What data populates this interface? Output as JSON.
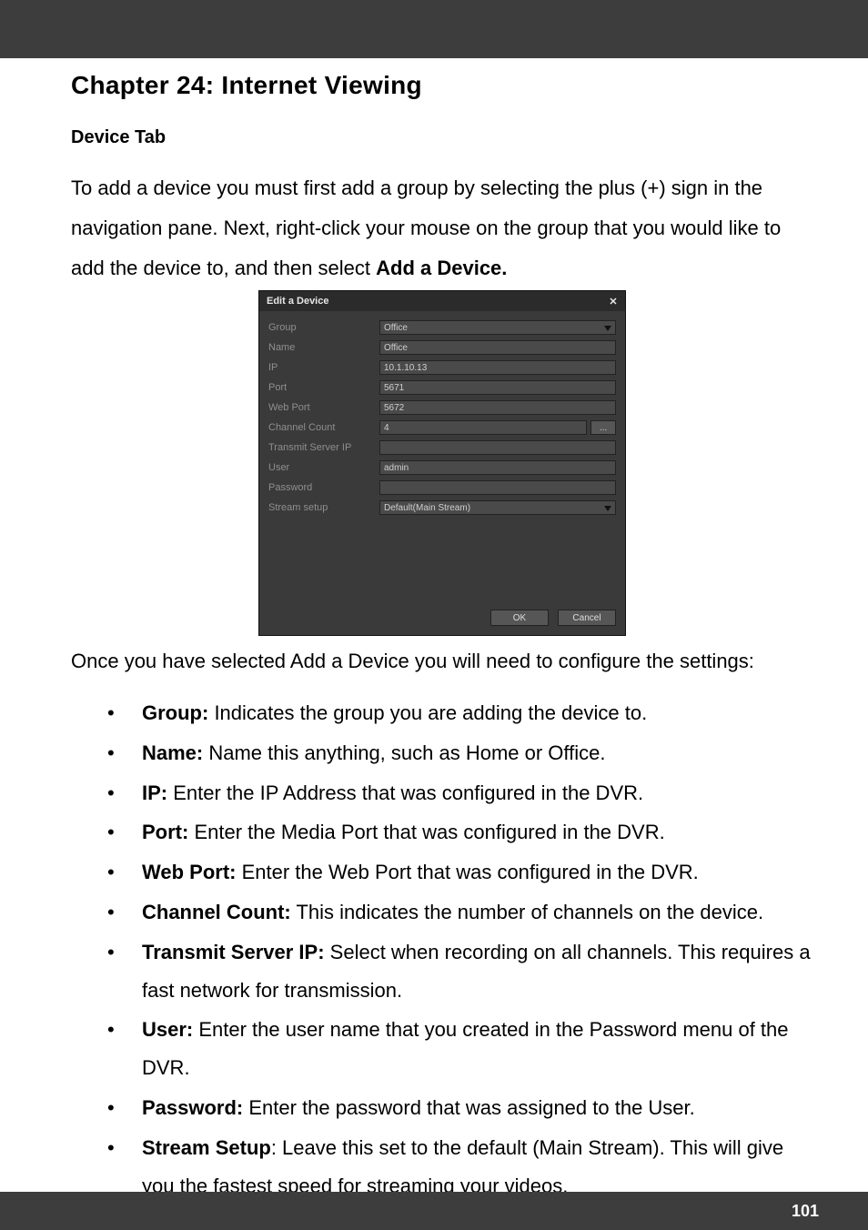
{
  "header": {
    "chapter_title": "Chapter 24: Internet Viewing"
  },
  "section": {
    "heading": "Device Tab"
  },
  "intro": {
    "text_a": "To add a device you must first add a group by selecting the plus (+) sign in the navigation pane. Next, right-click your mouse on the group that you would like to add the device to, and then select ",
    "text_b": "Add a Device."
  },
  "dialog": {
    "title": "Edit a Device",
    "fields": {
      "group": {
        "label": "Group",
        "value": "Office"
      },
      "name": {
        "label": "Name",
        "value": "Office"
      },
      "ip": {
        "label": "IP",
        "value": "10.1.10.13"
      },
      "port": {
        "label": "Port",
        "value": "5671"
      },
      "web_port": {
        "label": "Web Port",
        "value": "5672"
      },
      "channel_count": {
        "label": "Channel Count",
        "value": "4",
        "ellipsis": "..."
      },
      "transmit_server_ip": {
        "label": "Transmit Server IP",
        "value": ""
      },
      "user": {
        "label": "User",
        "value": "admin"
      },
      "password": {
        "label": "Password",
        "value": ""
      },
      "stream_setup": {
        "label": "Stream setup",
        "value": "Default(Main Stream)"
      }
    },
    "buttons": {
      "ok": "OK",
      "cancel": "Cancel"
    },
    "close_glyph": "✕"
  },
  "after_dialog": {
    "text": "Once you have selected Add a Device you will need to configure the settings:"
  },
  "bullets": [
    {
      "term": "Group:",
      "desc": " Indicates the group you are adding the device to."
    },
    {
      "term": "Name:",
      "desc": " Name this anything, such as Home or Office."
    },
    {
      "term": "IP:",
      "desc": " Enter the IP Address that was configured in the DVR."
    },
    {
      "term": "Port:",
      "desc": " Enter the Media Port that was configured in the DVR."
    },
    {
      "term": "Web Port:",
      "desc": " Enter the Web Port that was configured in the DVR."
    },
    {
      "term": "Channel Count:",
      "desc": " This indicates the number of channels on the device."
    },
    {
      "term": "Transmit Server IP:",
      "desc": " Select when recording on all channels. This requires a fast network for transmission."
    },
    {
      "term": "User:",
      "desc": " Enter the user name that you created in the Password menu of the DVR."
    },
    {
      "term": "Password:",
      "desc": " Enter the password that was assigned to the User."
    },
    {
      "term": "Stream Setup",
      "desc": ": Leave this set to the default (Main Stream). This will give you the fastest speed for streaming your videos."
    }
  ],
  "footer": {
    "page_number": "101"
  }
}
